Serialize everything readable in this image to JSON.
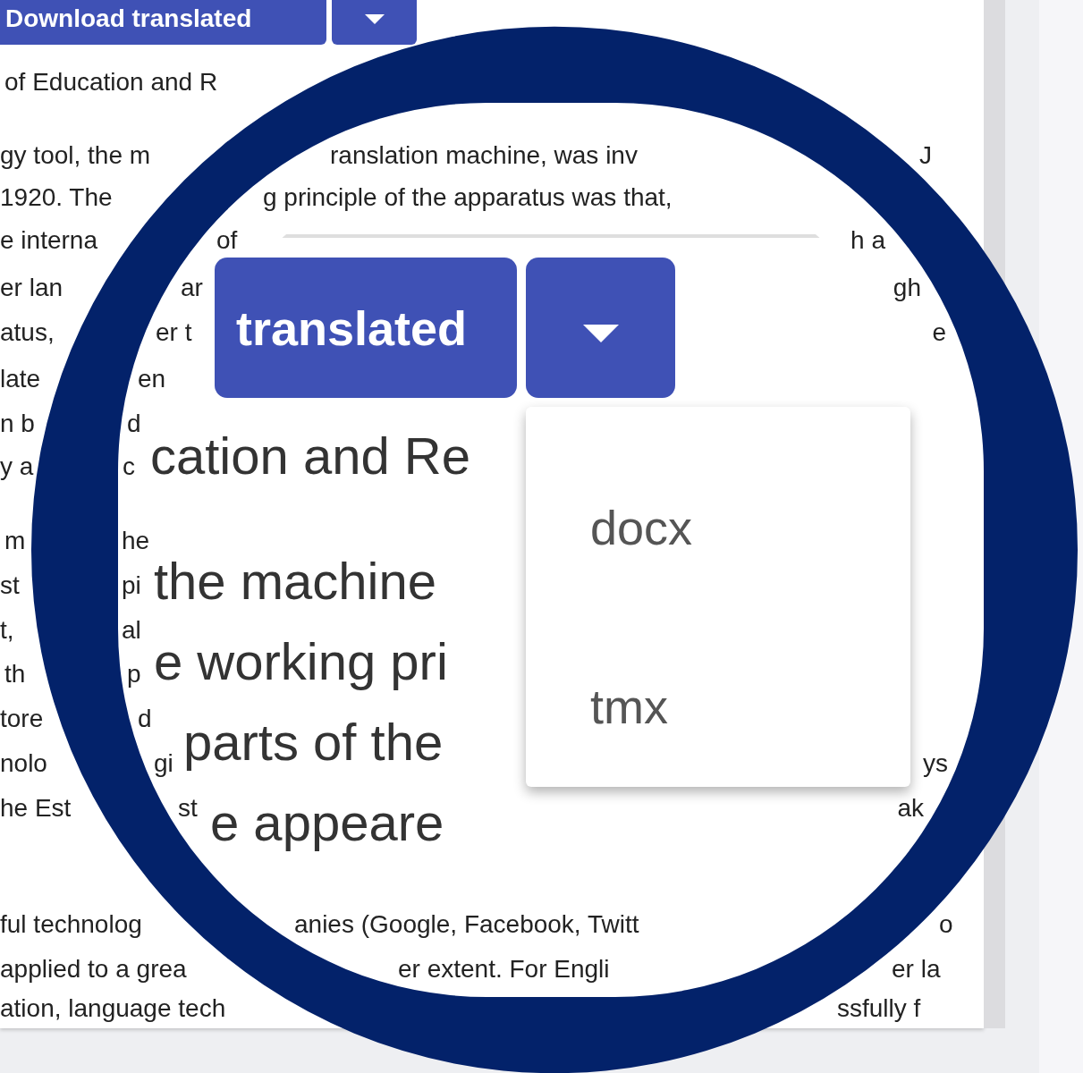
{
  "toolbar": {
    "download_button": "Download translated"
  },
  "page_text": [
    [
      "of Education and R"
    ],
    [
      "gy tool, the m",
      "ranslation machine, was inv",
      "J"
    ],
    [
      "1920. The",
      "g principle of the apparatus was that,"
    ],
    [
      "e interna",
      "of",
      "h a"
    ],
    [
      "er lan",
      "ar",
      "gh"
    ],
    [
      "atus,",
      "er t",
      "e"
    ],
    [
      "late",
      "en"
    ],
    [
      "n b",
      "d"
    ],
    [
      "y a",
      "c"
    ],
    [
      "m",
      "he"
    ],
    [
      "st",
      "pi"
    ],
    [
      "t,",
      "al"
    ],
    [
      "th",
      "p"
    ],
    [
      "tore",
      "d"
    ],
    [
      "nolo",
      "gi",
      "ys"
    ],
    [
      "he Est",
      "st",
      "ak"
    ],
    [
      "ful technolog",
      "anies (Google, Facebook, Twitt",
      "o"
    ],
    [
      "applied to a grea",
      "er extent. For Engli",
      "er la"
    ],
    [
      "ation, language tech",
      "ssfully f"
    ]
  ],
  "magnifier": {
    "download_button": "translated",
    "text_lines": [
      "cation and Re",
      "the machine",
      "e working pri",
      "parts of the",
      "e appeare"
    ],
    "menu_items": [
      {
        "label": "docx"
      },
      {
        "label": "tmx"
      }
    ]
  }
}
